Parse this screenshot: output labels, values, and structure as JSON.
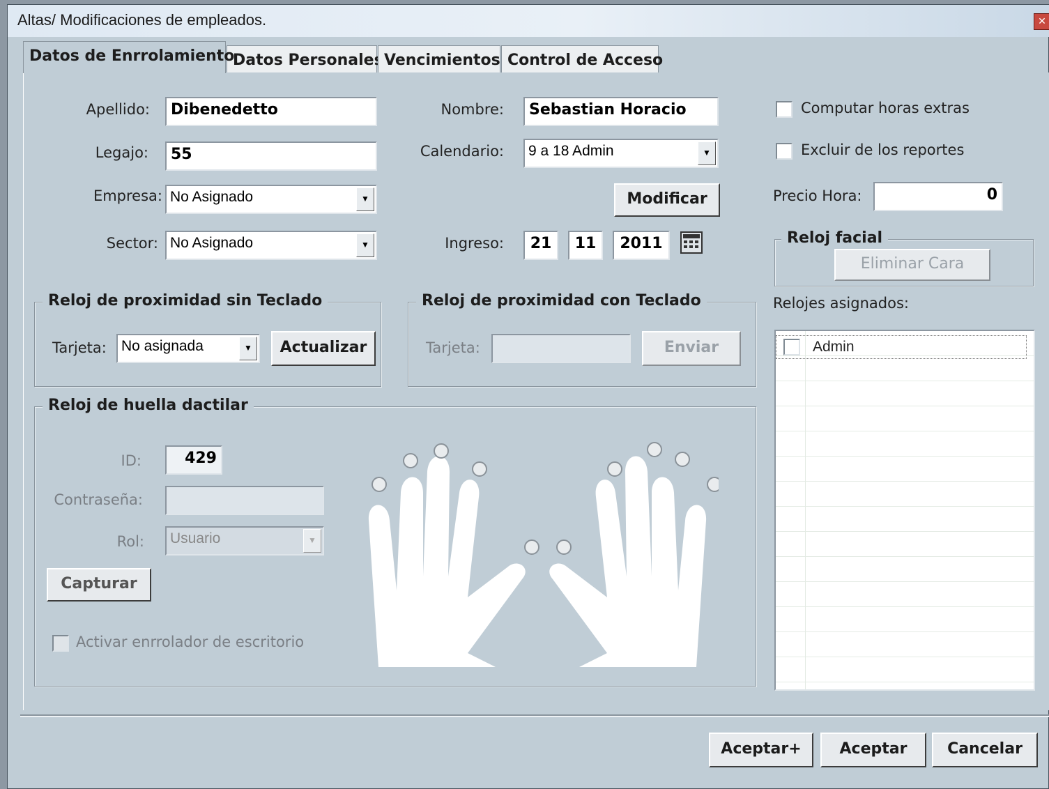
{
  "window": {
    "title": "Altas/ Modificaciones de empleados."
  },
  "tabs": [
    {
      "label": "Datos de Enrrolamiento",
      "active": true
    },
    {
      "label": "Datos Personales",
      "active": false
    },
    {
      "label": "Vencimientos",
      "active": false
    },
    {
      "label": "Control de Acceso",
      "active": false
    }
  ],
  "form": {
    "apellido_label": "Apellido:",
    "apellido_value": "Dibenedetto",
    "nombre_label": "Nombre:",
    "nombre_value": "Sebastian Horacio",
    "legajo_label": "Legajo:",
    "legajo_value": "55",
    "calendario_label": "Calendario:",
    "calendario_value": "9 a 18 Admin",
    "empresa_label": "Empresa:",
    "empresa_value": "No Asignado",
    "modificar_label": "Modificar",
    "sector_label": "Sector:",
    "sector_value": "No Asignado",
    "ingreso_label": "Ingreso:",
    "ingreso_day": "21",
    "ingreso_month": "11",
    "ingreso_year": "2011"
  },
  "options": {
    "computar_label": "Computar horas extras",
    "computar_checked": false,
    "excluir_label": "Excluir de los reportes",
    "excluir_checked": false,
    "precio_label": "Precio Hora:",
    "precio_value": "0"
  },
  "reloj_facial": {
    "title": "Reloj facial",
    "eliminar_label": "Eliminar Cara"
  },
  "relojes": {
    "label": "Relojes asignados:",
    "items": [
      {
        "label": "Admin",
        "checked": false
      }
    ]
  },
  "prox_sin": {
    "title": "Reloj de proximidad sin Teclado",
    "tarjeta_label": "Tarjeta:",
    "tarjeta_value": "No asignada",
    "actualizar_label": "Actualizar"
  },
  "prox_con": {
    "title": "Reloj de proximidad con Teclado",
    "tarjeta_label": "Tarjeta:",
    "tarjeta_value": "",
    "enviar_label": "Enviar"
  },
  "huella": {
    "title": "Reloj de huella dactilar",
    "id_label": "ID:",
    "id_value": "429",
    "password_label": "Contraseña:",
    "password_value": "",
    "rol_label": "Rol:",
    "rol_value": "Usuario",
    "capturar_label": "Capturar",
    "activar_label": "Activar enrrolador de escritorio",
    "activar_checked": false
  },
  "footer": {
    "aceptar_plus": "Aceptar+",
    "aceptar": "Aceptar",
    "cancelar": "Cancelar"
  },
  "icons": {
    "close": "close-icon",
    "calendar": "calendar-icon",
    "dropdown": "chevron-down-icon",
    "hands": "hands-diagram-icon"
  }
}
